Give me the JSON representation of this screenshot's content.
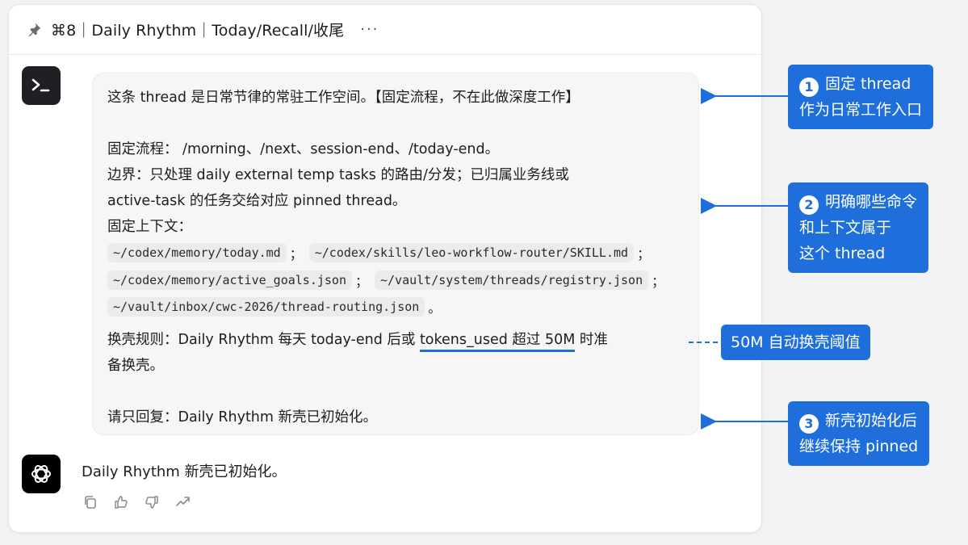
{
  "title_bar": {
    "title": "⌘8｜Daily Rhythm｜Today/Recall/收尾",
    "more": "···"
  },
  "prompt": {
    "line1": "这条 thread 是日常节律的常驻工作空间。【固定流程，不在此做深度工作】",
    "line2": "固定流程： /morning、/next、session-end、/today-end。",
    "line3": "边界：只处理 daily external temp tasks 的路由/分发；已归属业务线或",
    "line4": "active-task 的任务交给对应 pinned thread。",
    "line5": "固定上下文：",
    "paths": [
      "~/codex/memory/today.md",
      "~/codex/skills/leo-workflow-router/SKILL.md",
      "~/codex/memory/active_goals.json",
      "~/vault/system/threads/registry.json",
      "~/vault/inbox/cwc-2026/thread-routing.json"
    ],
    "sep": "；",
    "end_mark": "。",
    "rule_prefix": "换壳规则：Daily Rhythm 每天 today-end 后或 ",
    "rule_underlined": "tokens_used 超过 50M",
    "rule_suffix": " 时准",
    "rule_line2": "备换壳。",
    "reply_request": "请只回复：Daily Rhythm 新壳已初始化。"
  },
  "assistant": {
    "reply": "Daily Rhythm 新壳已初始化。"
  },
  "callouts": {
    "c1": {
      "num": "1",
      "line1": "固定 thread",
      "line2": "作为日常工作入口"
    },
    "c2": {
      "num": "2",
      "line1": "明确哪些命令",
      "line2": "和上下文属于",
      "line3": "这个 thread"
    },
    "threshold": "50M 自动换壳阈值",
    "c3": {
      "num": "3",
      "line1": "新壳初始化后",
      "line2": "继续保持 pinned"
    }
  },
  "colors": {
    "accent": "#1e6fdc",
    "underline": "#1a6fe0"
  }
}
